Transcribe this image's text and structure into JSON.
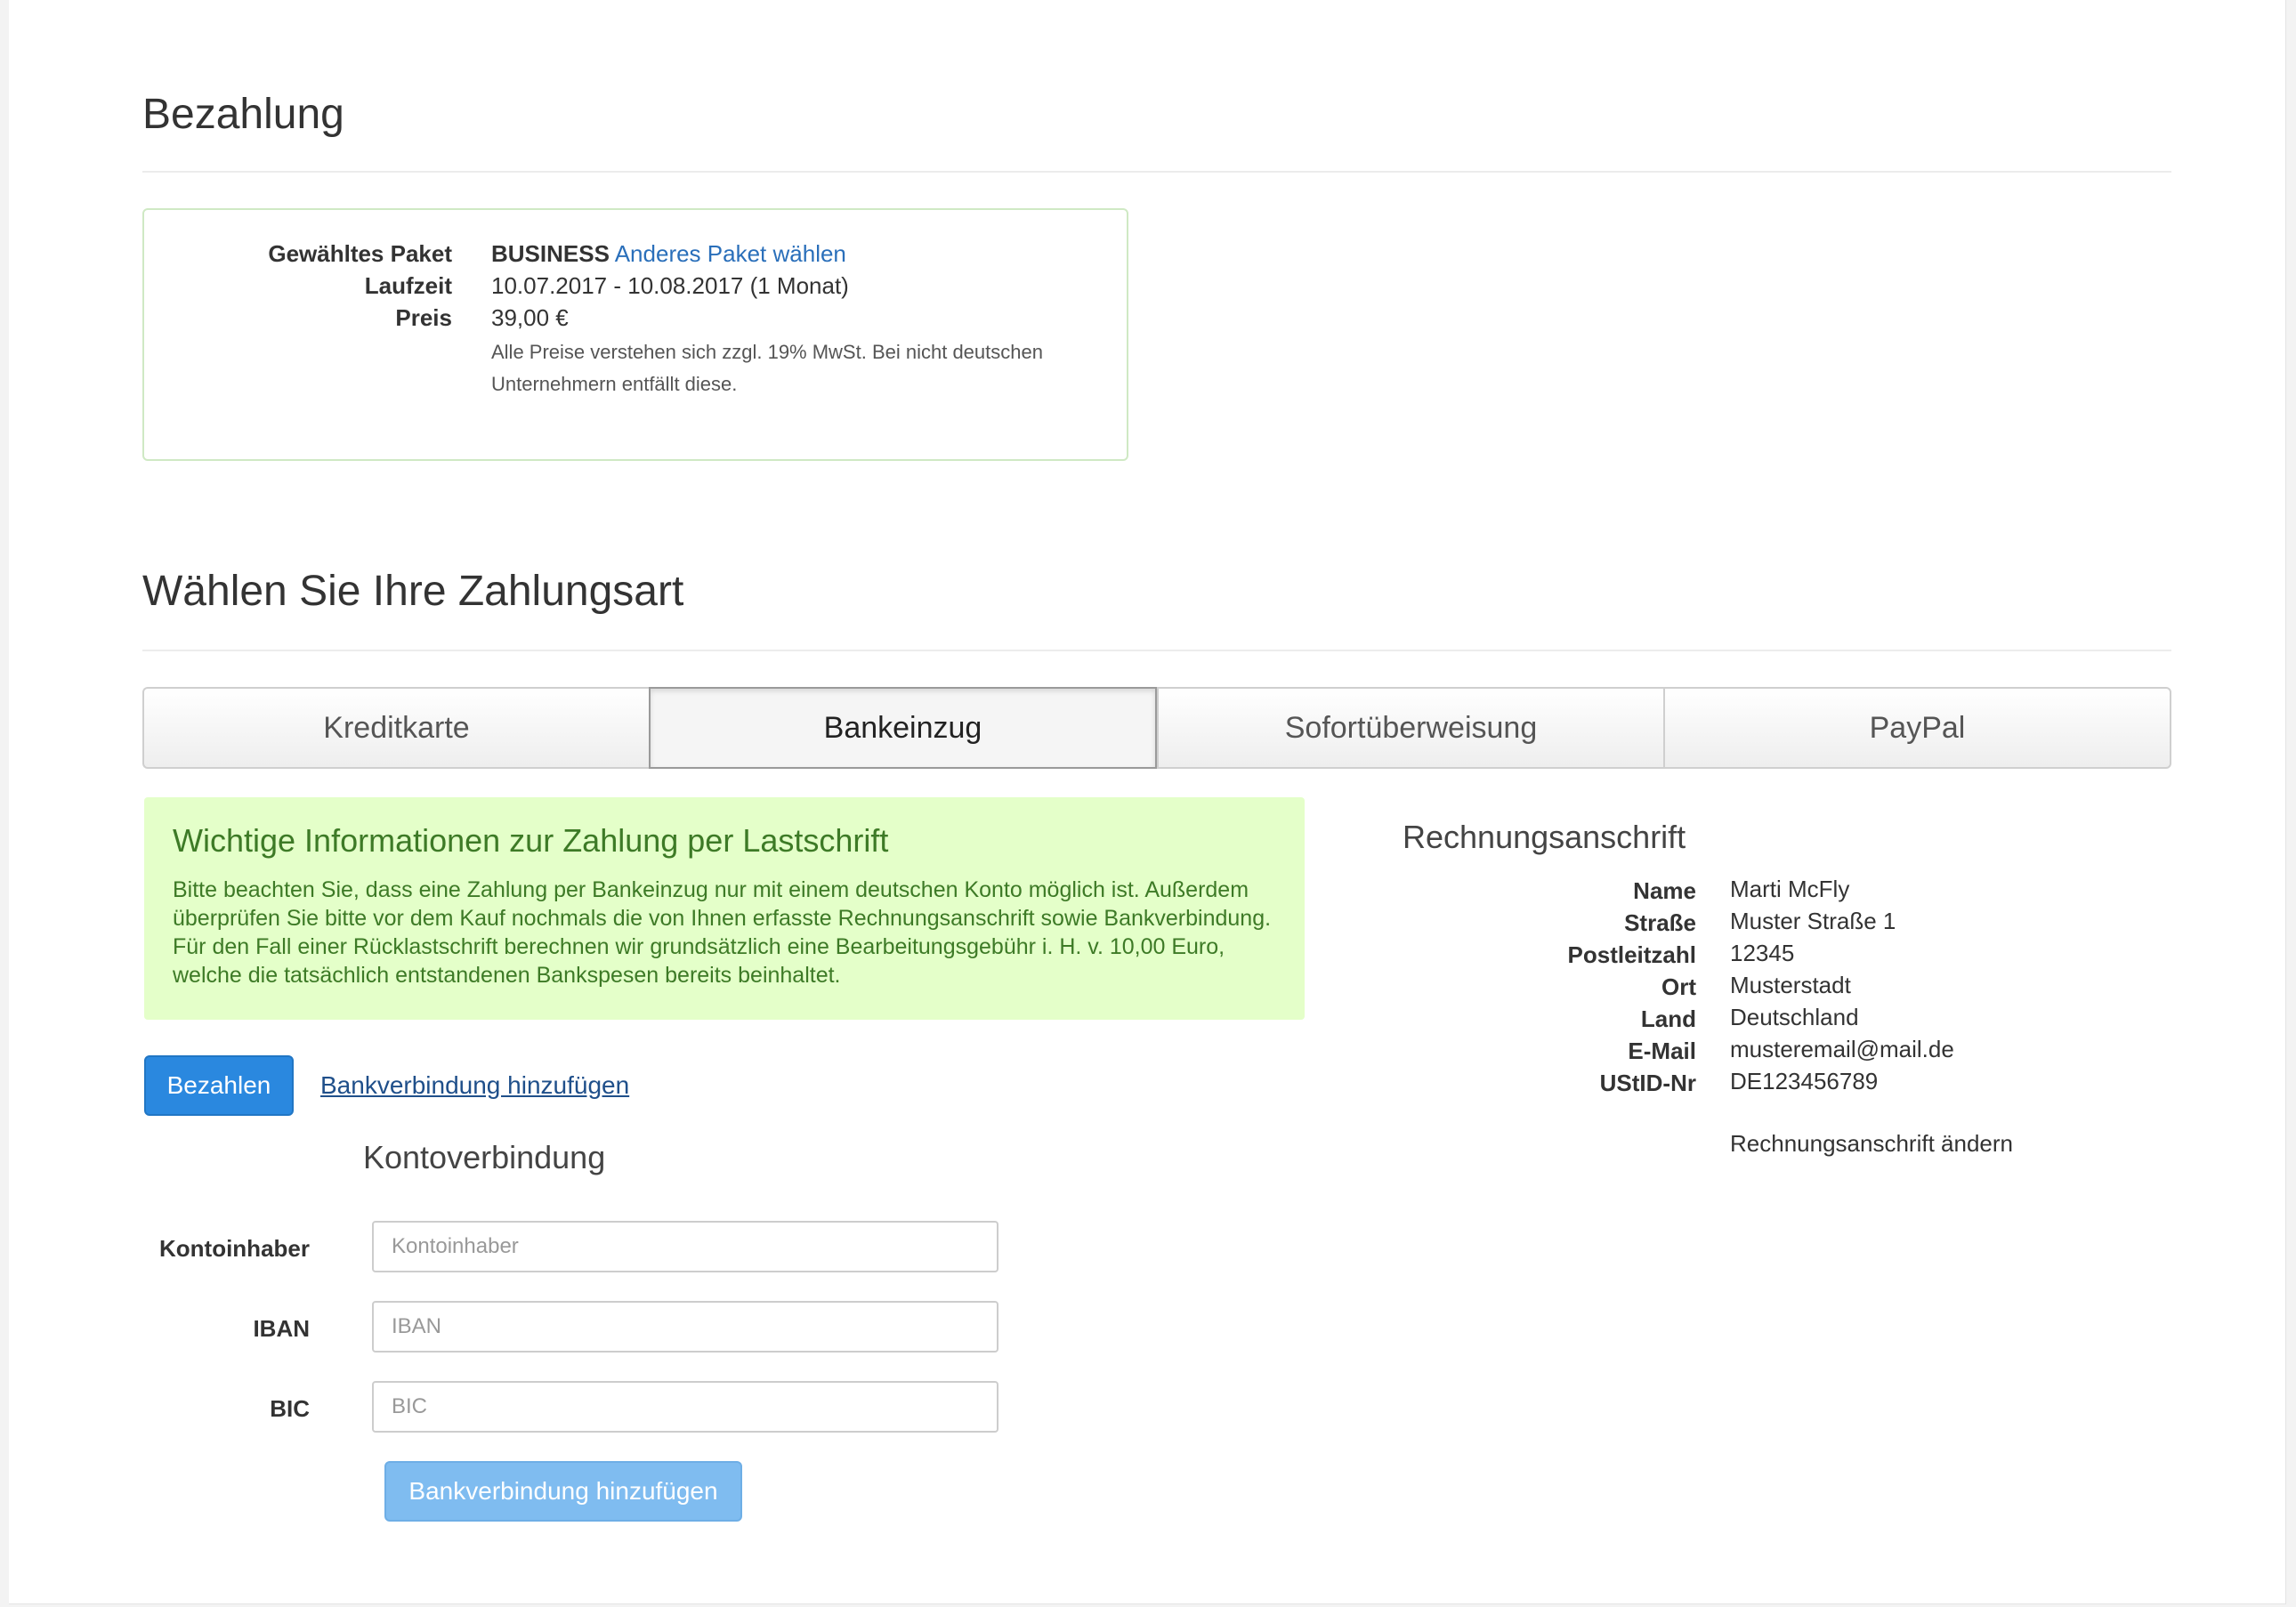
{
  "page": {
    "title": "Bezahlung"
  },
  "package": {
    "chosen_label": "Gewähltes Paket",
    "chosen_value": "BUSINESS",
    "change_link": "Anderes Paket wählen",
    "duration_label": "Laufzeit",
    "duration_value": "10.07.2017 - 10.08.2017 (1 Monat)",
    "price_label": "Preis",
    "price_value": "39,00 €",
    "tax_note": "Alle Preise verstehen sich zzgl. 19% MwSt. Bei nicht deutschen Unternehmern entfällt diese."
  },
  "payment": {
    "heading": "Wählen Sie Ihre Zahlungsart",
    "tabs": [
      "Kreditkarte",
      "Bankeinzug",
      "Sofortüberweisung",
      "PayPal"
    ],
    "active_tab": "Bankeinzug"
  },
  "info": {
    "title": "Wichtige Informationen zur Zahlung per Lastschrift",
    "text": "Bitte beachten Sie, dass eine Zahlung per Bankeinzug nur mit einem deutschen Konto möglich ist. Außerdem überprüfen Sie bitte vor dem Kauf nochmals die von Ihnen erfasste Rechnungsanschrift sowie Bankverbindung. Für den Fall einer Rücklastschrift berechnen wir grundsätzlich eine Bearbeitungsgebühr i. H. v. 10,00 Euro, welche die tatsächlich entstandenen Bankspesen bereits beinhaltet."
  },
  "actions": {
    "pay_button": "Bezahlen",
    "add_bank_link": "Bankverbindung hinzufügen"
  },
  "bank_form": {
    "heading": "Kontoverbindung",
    "holder_label": "Kontoinhaber",
    "holder_placeholder": "Kontoinhaber",
    "iban_label": "IBAN",
    "iban_placeholder": "IBAN",
    "bic_label": "BIC",
    "bic_placeholder": "BIC",
    "submit_button": "Bankverbindung hinzufügen"
  },
  "billing": {
    "heading": "Rechnungsanschrift",
    "fields": [
      {
        "label": "Name",
        "value": "Marti McFly"
      },
      {
        "label": "Straße",
        "value": "Muster Straße 1"
      },
      {
        "label": "Postleitzahl",
        "value": "12345"
      },
      {
        "label": "Ort",
        "value": "Musterstadt"
      },
      {
        "label": "Land",
        "value": "Deutschland"
      },
      {
        "label": "E-Mail",
        "value": "musteremail@mail.de"
      },
      {
        "label": "UStID-Nr",
        "value": "DE123456789"
      }
    ],
    "change_link": "Rechnungsanschrift ändern"
  },
  "colors": {
    "primary": "#2a88df",
    "link": "#2a6fba",
    "info_bg": "#e4ffc9",
    "info_text": "#3d7a26"
  }
}
